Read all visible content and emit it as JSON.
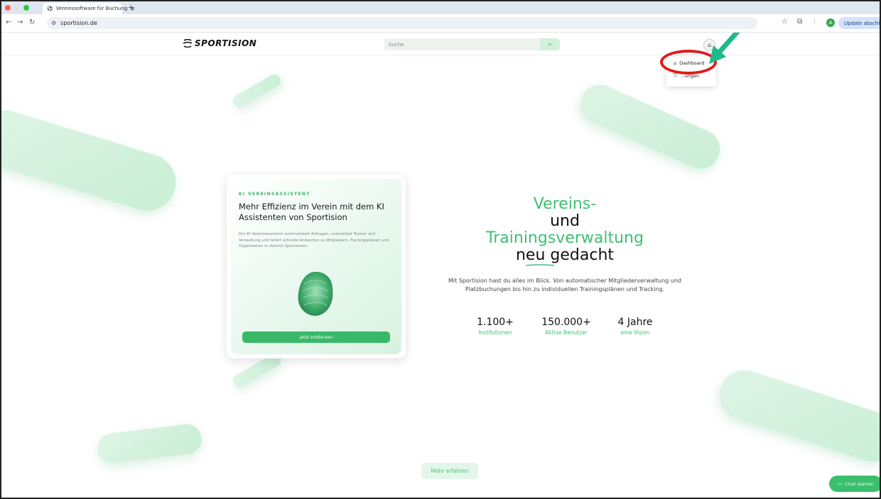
{
  "browser": {
    "tab_title": "Vereinssoftware für Buchung",
    "url": "sportision.de",
    "update_label": "Update abschließen",
    "profile_initial": "A"
  },
  "header": {
    "logo_text": "SPORTISION",
    "search_placeholder": "Suche"
  },
  "dropdown": {
    "items": [
      {
        "label": "Dashboard",
        "icon": "home-icon"
      },
      {
        "label": "…ungen",
        "icon": "logout-icon"
      }
    ]
  },
  "card": {
    "kicker": "KI VEREINSASSISTENT",
    "title": "Mehr Effizienz im Verein mit dem KI Assistenten von Sportision",
    "description": "Der KI Vereinsassistent automatisiert Anfragen, unterstützt Trainer und Verwaltung und liefert schnelle Antworten zu Mitgliedern, Trainingsplänen und Organisation in deinem Sportverein.",
    "button": "Jetzt entdecken"
  },
  "hero": {
    "line1": "Vereins-",
    "line2": "und",
    "line3": "Trainingsverwaltung",
    "line4": "neu gedacht",
    "text": "Mit Sportision hast du alles im Blick. Von automatischer Mitgliederverwaltung und Platzbuchungen bis hin zu individuellen Trainingsplänen und Tracking.",
    "stats": [
      {
        "value": "1.100+",
        "label": "Institutionen"
      },
      {
        "value": "150.000+",
        "label": "Aktive Benutzer"
      },
      {
        "value": "4 Jahre",
        "label": "eine Vision"
      }
    ]
  },
  "more_button": "Mehr erfahren",
  "chat_button": "Chat starten",
  "colors": {
    "accent": "#3fbf73",
    "annotation_red": "#e01a1a",
    "annotation_arrow": "#1fb98a"
  }
}
